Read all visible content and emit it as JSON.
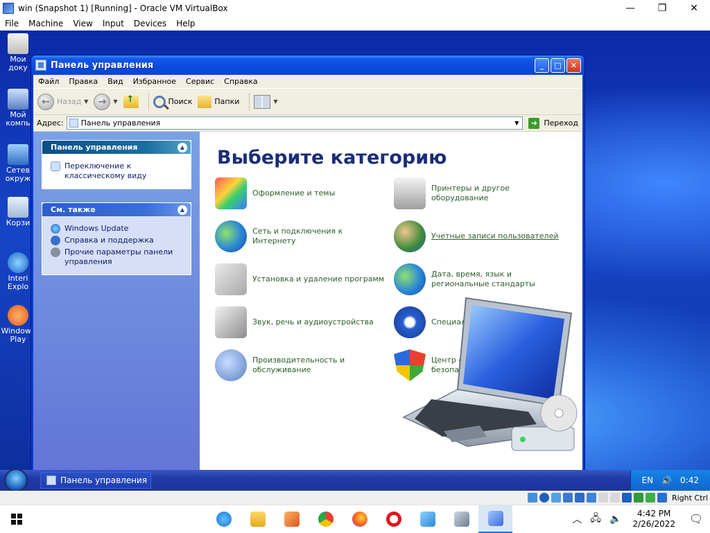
{
  "vbox": {
    "title": "win (Snapshot 1) [Running] - Oracle VM VirtualBox",
    "controls": {
      "minimize": "—",
      "maximize": "❐",
      "close": "✕"
    },
    "menu": [
      "File",
      "Machine",
      "View",
      "Input",
      "Devices",
      "Help"
    ],
    "status_right_ctrl": "Right Ctrl"
  },
  "desktop_icons": [
    {
      "label": "Мои доку"
    },
    {
      "label": "Мой компь"
    },
    {
      "label": "Сетев окруж"
    },
    {
      "label": "Корзи"
    },
    {
      "label": "Interi Explo"
    },
    {
      "label": "Windows Play"
    }
  ],
  "explorer": {
    "title": "Панель управления",
    "menu": [
      "Файл",
      "Правка",
      "Вид",
      "Избранное",
      "Сервис",
      "Справка"
    ],
    "toolbar": {
      "back": "Назад",
      "search": "Поиск",
      "folders": "Папки"
    },
    "address_label": "Адрес:",
    "address_value": "Панель управления",
    "go_label": "Переход",
    "task_pane": {
      "box1": {
        "header": "Панель управления",
        "items": [
          "Переключение к классическому виду"
        ]
      },
      "box2": {
        "header": "См. также",
        "items": [
          "Windows Update",
          "Справка и поддержка",
          "Прочие параметры панели управления"
        ]
      }
    },
    "main_title": "Выберите категорию",
    "categories_left": [
      "Оформление и темы",
      "Сеть и подключения к Интернету",
      "Установка и удаление программ",
      "Звук, речь и аудиоустройства",
      "Производительность и обслуживание"
    ],
    "categories_right": [
      "Принтеры и другое оборудование",
      "Учетные записи пользователей",
      "Дата, время, язык и региональные стандарты",
      "Специальные возможности",
      "Центр обеспечения безопасности"
    ]
  },
  "xp_taskbar": {
    "task_label": "Панель управления",
    "lang": "EN",
    "time": "0:42"
  },
  "host_taskbar": {
    "time": "4:42 PM",
    "date": "2/26/2022"
  },
  "colors": {
    "xp_title_blue": "#0b4ade",
    "category_text": "#2a5e2a",
    "main_title": "#1a2d78"
  }
}
